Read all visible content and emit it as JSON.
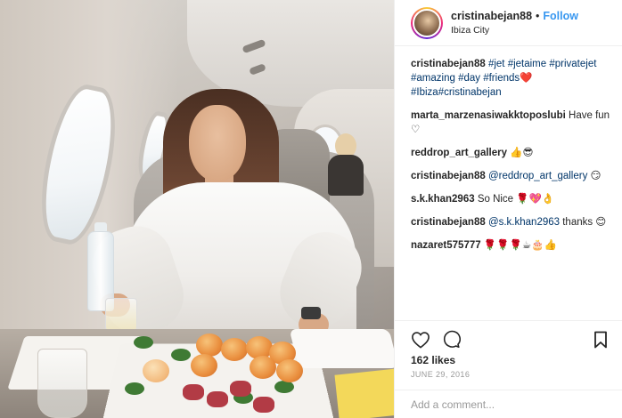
{
  "post": {
    "author": "cristinabejan88",
    "follow_label": "Follow",
    "separator": "•",
    "location": "Ibiza City"
  },
  "caption": {
    "author": "cristinabejan88",
    "hashtags": [
      "#jet",
      "#jetaime",
      "#privatejet",
      "#amazing",
      "#day",
      "#friends",
      "#Ibiza",
      "#cristinabejan"
    ],
    "emoji": "❤️"
  },
  "comments": [
    {
      "author": "marta_marzenasiwakktoposlubi",
      "text": "Have fun ♡"
    },
    {
      "author": "reddrop_art_gallery",
      "text": "👍😎"
    },
    {
      "author": "cristinabejan88",
      "mention": "@reddrop_art_gallery",
      "text": "😏"
    },
    {
      "author": "s.k.khan2963",
      "text": "So Nice 🌹💖👌"
    },
    {
      "author": "cristinabejan88",
      "mention": "@s.k.khan2963",
      "text": "thanks 😊"
    },
    {
      "author": "nazaret575777",
      "text": "🌹🌹🌹☕🎂👍"
    }
  ],
  "actions": {
    "like_icon": "heart-outline-icon",
    "comment_icon": "speech-bubble-icon",
    "save_icon": "bookmark-icon"
  },
  "likes_text": "162 likes",
  "date_text": "JUNE 29, 2016",
  "add_comment": {
    "placeholder": "Add a comment..."
  },
  "colors": {
    "link": "#3897f0",
    "hashtag": "#003569",
    "muted": "#999999",
    "text": "#262626"
  }
}
